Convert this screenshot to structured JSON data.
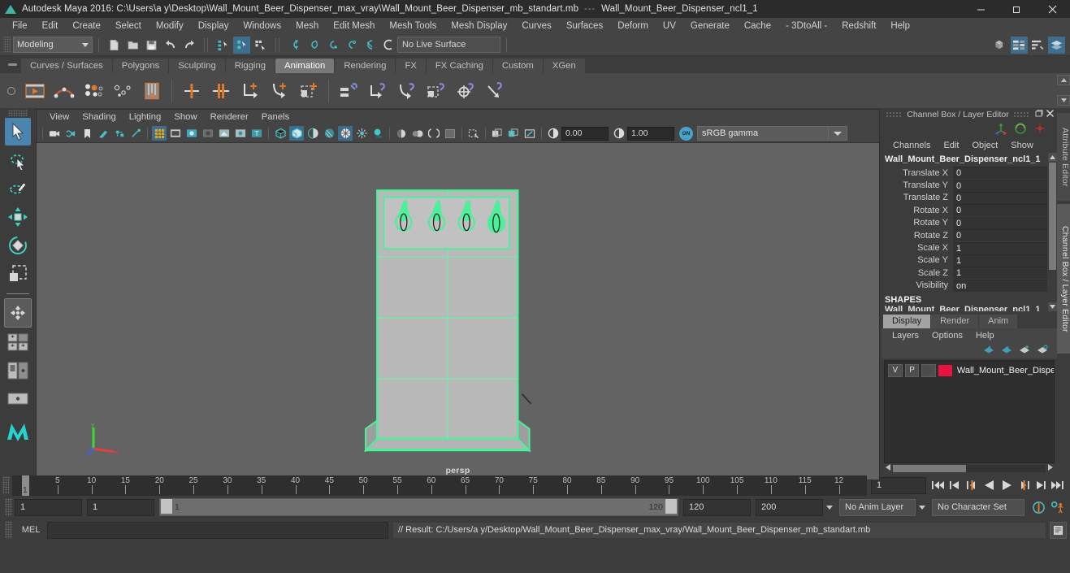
{
  "window": {
    "title": "Autodesk Maya 2016: C:\\Users\\a y\\Desktop\\Wall_Mount_Beer_Dispenser_max_vray\\Wall_Mount_Beer_Dispenser_mb_standart.mb",
    "separator": "---",
    "subtitle": "Wall_Mount_Beer_Dispenser_ncl1_1",
    "minimize": "minimize-icon",
    "restore": "restore-icon",
    "close": "close-icon"
  },
  "menubar": {
    "items": [
      "File",
      "Edit",
      "Create",
      "Select",
      "Modify",
      "Display",
      "Windows",
      "Mesh",
      "Edit Mesh",
      "Mesh Tools",
      "Mesh Display",
      "Curves",
      "Surfaces",
      "Deform",
      "UV",
      "Generate",
      "Cache",
      "- 3DtoAll -",
      "Redshift",
      "Help"
    ]
  },
  "statusline": {
    "menuset": "Modeling",
    "live_surface": "No Live Surface",
    "icons_file": [
      "new-scene-icon",
      "open-scene-icon",
      "save-scene-icon",
      "undo-icon",
      "redo-icon"
    ],
    "icons_selmask": [
      "select-by-hierarchy-icon",
      "select-by-object-type-icon",
      "select-by-component-type-icon"
    ],
    "icons_snap": [
      "snap-to-grid-icon",
      "snap-to-curve-icon",
      "snap-to-point-icon",
      "snap-to-projected-center-icon",
      "snap-to-view-plane-icon",
      "make-live-icon"
    ],
    "icons_right": [
      "modeling-toolkit-icon",
      "attribute-editor-icon",
      "tool-settings-icon",
      "channel-box-icon"
    ]
  },
  "shelf": {
    "tabs": [
      "Curves / Surfaces",
      "Polygons",
      "Sculpting",
      "Rigging",
      "Animation",
      "Rendering",
      "FX",
      "FX Caching",
      "Custom",
      "XGen"
    ],
    "active_tab": "Animation",
    "buttons": [
      "playblast-icon",
      "set-key-icon",
      "set-breakdown-key-icon",
      "set-driven-key-icon",
      "ghost-selected-icon",
      "set-key-translate-icon",
      "set-key-rotate-icon",
      "ik-fk-key-icon",
      "ik-handle-key-icon",
      "key-selected-icon",
      "parent-constraint-icon",
      "point-constraint-icon",
      "orient-constraint-icon",
      "scale-constraint-icon",
      "aim-constraint-icon",
      "pole-vector-constraint-icon"
    ]
  },
  "toolbox": {
    "items": [
      {
        "name": "select-tool",
        "selected": true
      },
      {
        "name": "lasso-select-tool",
        "selected": false
      },
      {
        "name": "paint-select-tool",
        "selected": false
      },
      {
        "name": "move-tool",
        "selected": false
      },
      {
        "name": "rotate-tool",
        "selected": false
      },
      {
        "name": "scale-tool",
        "selected": false
      },
      {
        "name": "last-tool-used",
        "selected": false
      },
      {
        "name": "four-view-layout",
        "selected": false
      },
      {
        "name": "persp-outliner-layout",
        "selected": false
      },
      {
        "name": "persp-graph-layout",
        "selected": false
      },
      {
        "name": "maya-logo-icon",
        "selected": false
      }
    ]
  },
  "viewport": {
    "menus": [
      "View",
      "Shading",
      "Lighting",
      "Show",
      "Renderer",
      "Panels"
    ],
    "camera_label": "persp",
    "exposure": "0.00",
    "gamma": "1.00",
    "color_space": "sRGB gamma",
    "toolbar_icons": [
      "select-camera-icon",
      "camera-attributes-icon",
      "bookmark-icon",
      "image-plane-icon",
      "two-sided-lighting-icon",
      "use-all-lights-icon",
      "grid-toggle-icon",
      "film-gate-icon",
      "resolution-gate-icon",
      "gate-mask-icon",
      "xray-icon",
      "xray-joints-icon",
      "texture-icon",
      "wireframe-shading-icon",
      "smooth-shade-all-icon",
      "smooth-shade-selected-icon",
      "flat-shade-icon",
      "wireframe-on-shaded-icon",
      "default-lighting-icon",
      "shadows-icon",
      "ambient-occlusion-icon",
      "motion-blur-icon",
      "multisample-icon",
      "isolate-select-icon",
      "panel-zoom-icon",
      "panel-duplicate-icon",
      "panel-snapshot-icon",
      "exposure-icon",
      "gamma-icon",
      "color-management-toggle-icon"
    ]
  },
  "channelbox": {
    "panel_title": "Channel Box / Layer Editor",
    "menus": [
      "Channels",
      "Edit",
      "Object",
      "Show"
    ],
    "object_name": "Wall_Mount_Beer_Dispenser_ncl1_1",
    "attributes": [
      {
        "label": "Translate X",
        "value": "0"
      },
      {
        "label": "Translate Y",
        "value": "0"
      },
      {
        "label": "Translate Z",
        "value": "0"
      },
      {
        "label": "Rotate X",
        "value": "0"
      },
      {
        "label": "Rotate Y",
        "value": "0"
      },
      {
        "label": "Rotate Z",
        "value": "0"
      },
      {
        "label": "Scale X",
        "value": "1"
      },
      {
        "label": "Scale Y",
        "value": "1"
      },
      {
        "label": "Scale Z",
        "value": "1"
      },
      {
        "label": "Visibility",
        "value": "on"
      }
    ],
    "shapes_header": "SHAPES",
    "shape_name": "Wall_Mount_Beer_Dispenser_ncl1_1",
    "icons": [
      "move-manip-icon",
      "rotate-manip-icon",
      "scale-manip-icon"
    ]
  },
  "dock_tabs": [
    {
      "label": "Attribute Editor",
      "active": false
    },
    {
      "label": "Channel Box / Layer Editor",
      "active": true
    }
  ],
  "layereditor": {
    "tabs": [
      "Display",
      "Render",
      "Anim"
    ],
    "active_tab": "Display",
    "menus": [
      "Layers",
      "Options",
      "Help"
    ],
    "toolbar_icons": [
      "layer-prev-icon",
      "layer-next-icon",
      "layer-new-icon",
      "layer-new-from-selected-icon"
    ],
    "layers": [
      {
        "visibility": "V",
        "playback": "P",
        "type": "",
        "color": "#e8133f",
        "name": "Wall_Mount_Beer_Dispe"
      }
    ]
  },
  "timeslider": {
    "start_tick": 1,
    "current_frame": "1",
    "tick_labels": [
      "5",
      "10",
      "15",
      "20",
      "25",
      "30",
      "35",
      "40",
      "45",
      "50",
      "55",
      "60",
      "65",
      "70",
      "75",
      "80",
      "85",
      "90",
      "95",
      "100",
      "105",
      "110",
      "115",
      "12"
    ],
    "current_field": "1",
    "playback_buttons": [
      "go-to-start-icon",
      "step-back-keyframe-icon",
      "step-back-frame-icon",
      "play-backwards-icon",
      "play-forwards-icon",
      "step-forward-frame-icon",
      "step-forward-keyframe-icon",
      "go-to-end-icon"
    ]
  },
  "rangeslider": {
    "anim_start": "1",
    "range_start": "1",
    "bar_left_label": "1",
    "bar_right_label": "120",
    "range_end": "120",
    "anim_end": "200",
    "anim_layer": "No Anim Layer",
    "character_set": "No Character Set",
    "icons": [
      "auto-keyframe-icon",
      "animation-preferences-icon"
    ]
  },
  "commandline": {
    "label": "MEL",
    "input_value": "",
    "output": "// Result: C:/Users/a y/Desktop/Wall_Mount_Beer_Dispenser_max_vray/Wall_Mount_Beer_Dispenser_mb_standart.mb",
    "script_editor_icon": "script-editor-icon"
  },
  "colors": {
    "selection_green": "#4cf09a",
    "accent_blue": "#3d6e8e",
    "layer_red": "#e8133f",
    "shelf_active": "#787878"
  }
}
